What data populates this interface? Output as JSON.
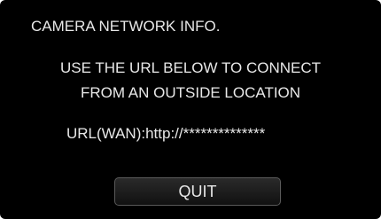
{
  "screen": {
    "title": "CAMERA NETWORK INFO.",
    "message_line1": "USE THE URL BELOW TO CONNECT",
    "message_line2": "FROM AN OUTSIDE LOCATION",
    "url_text": "URL(WAN):http://**************",
    "quit_label": "QUIT"
  },
  "colors": {
    "background": "#000000",
    "text": "#e8e8e8",
    "button_border": "#5a5a5a"
  }
}
